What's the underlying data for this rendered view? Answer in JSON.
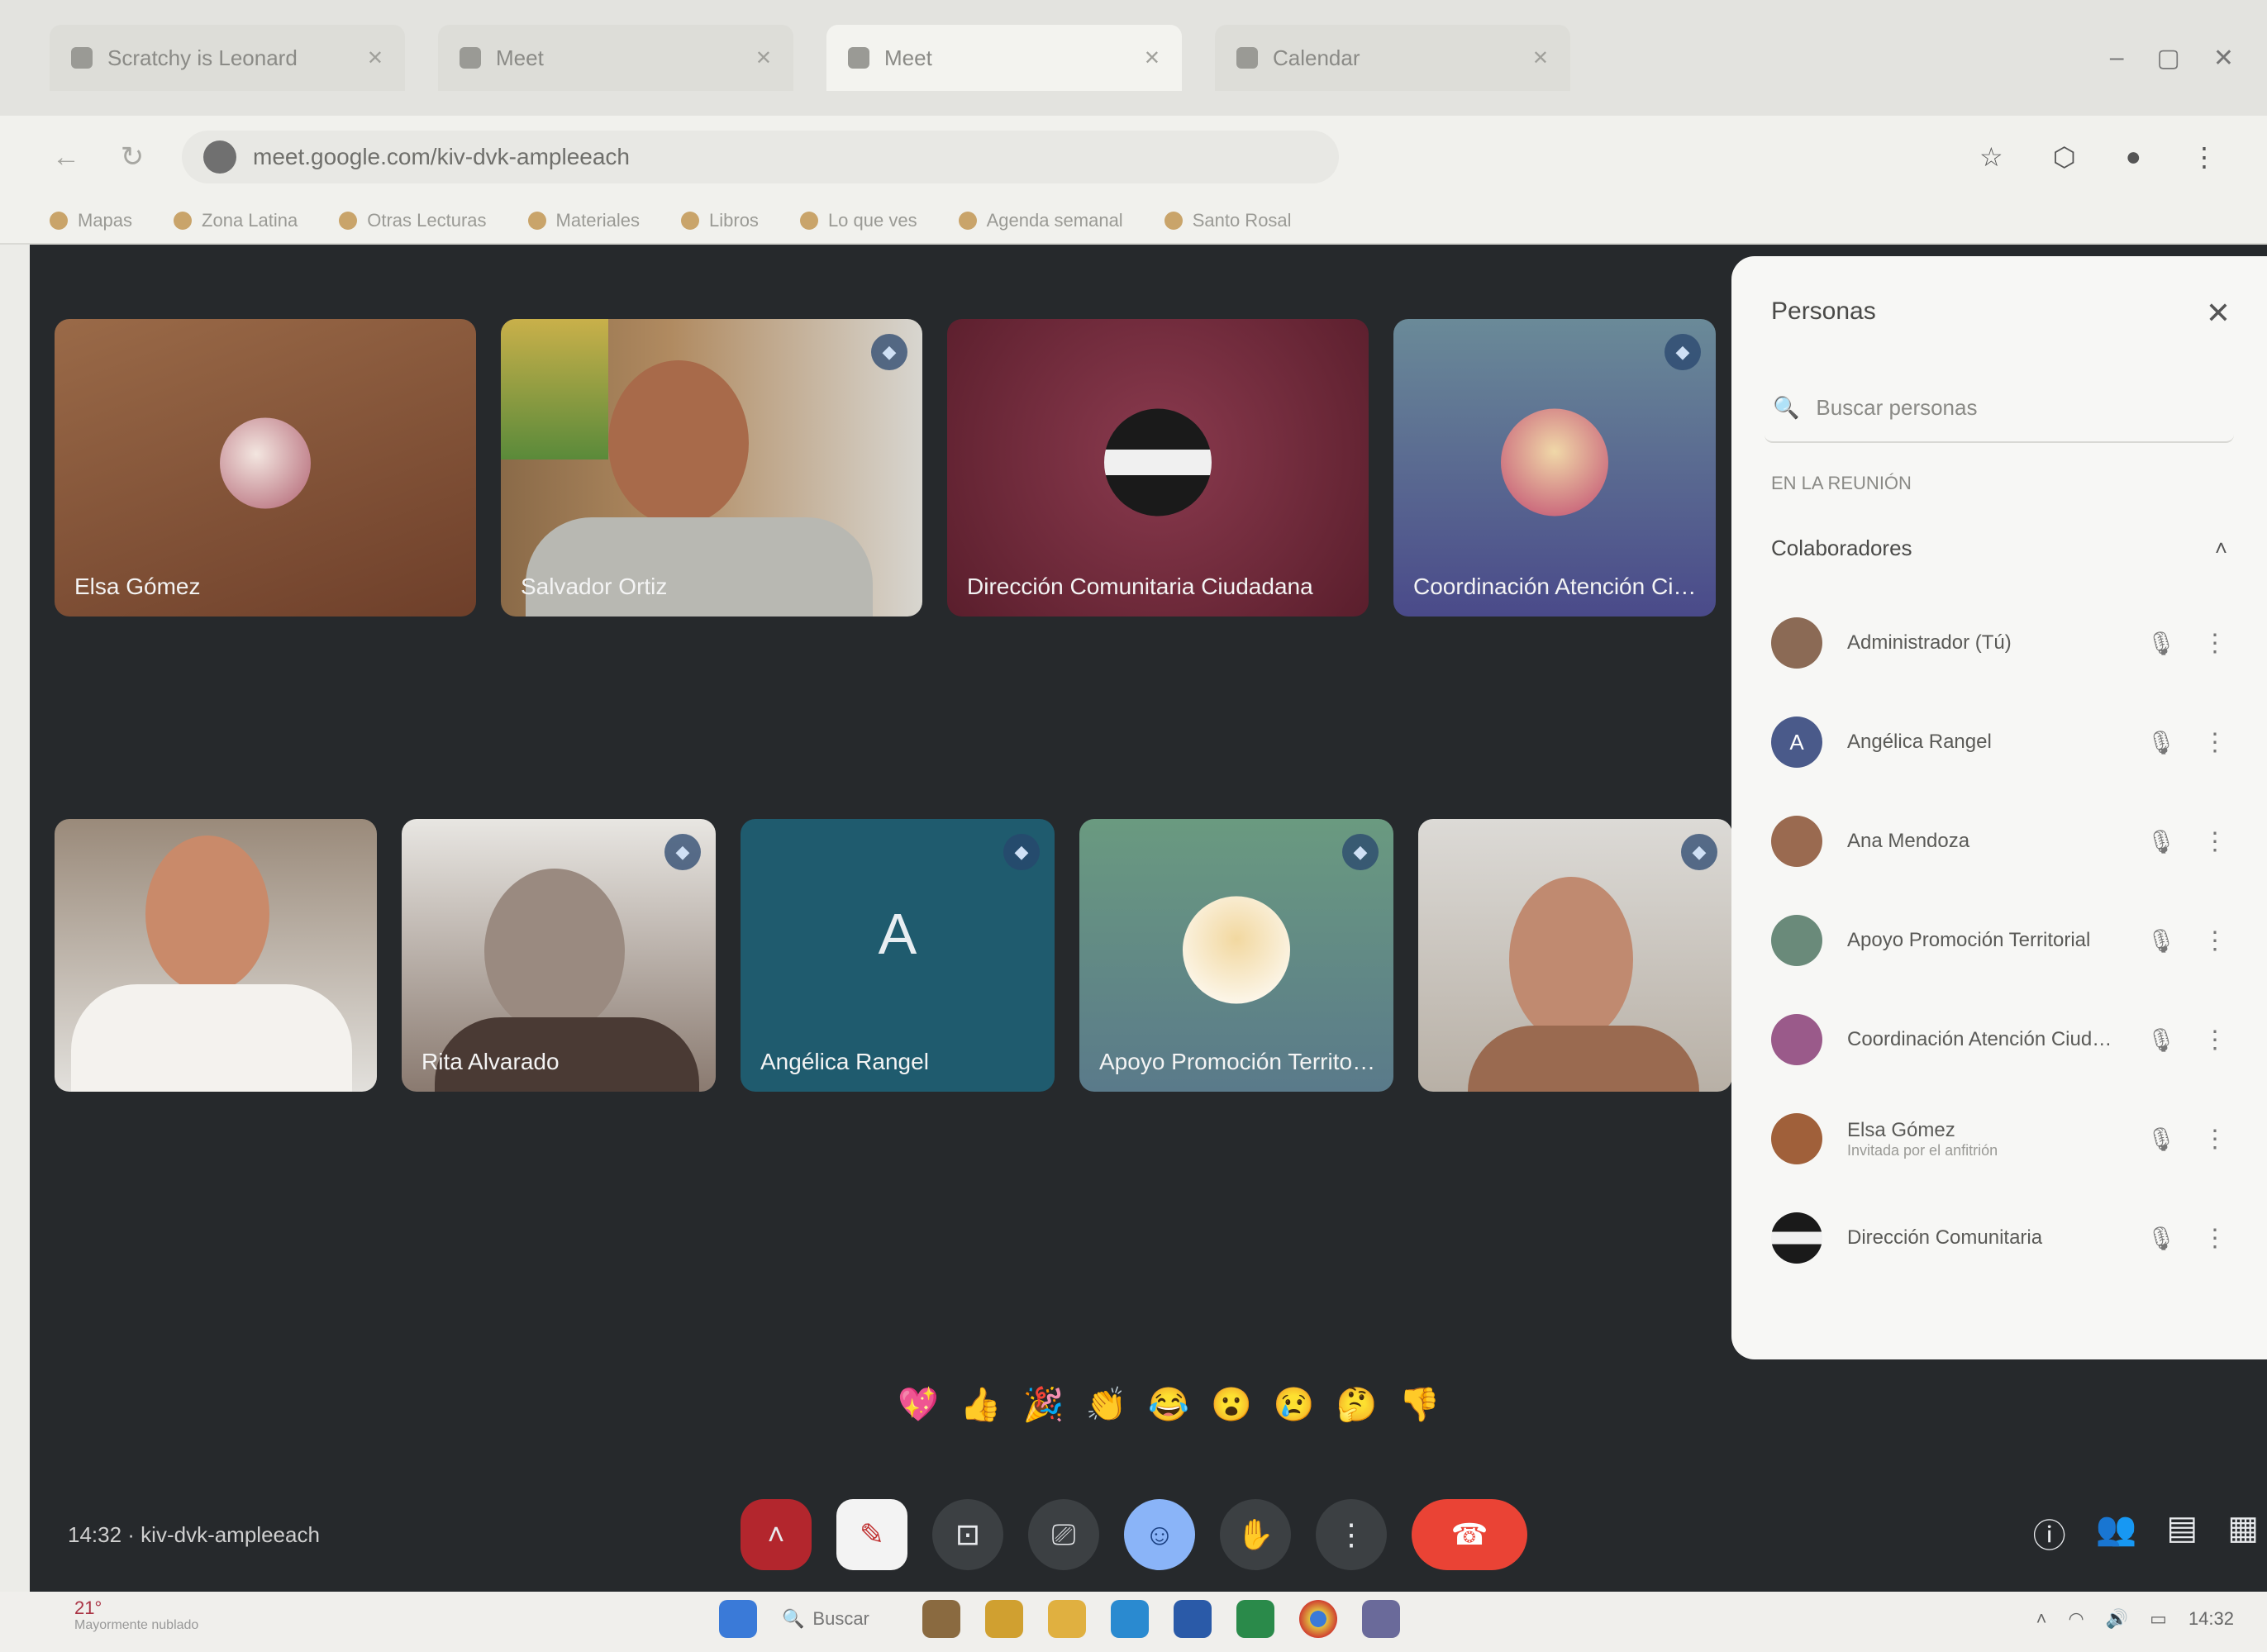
{
  "browser": {
    "tabs": [
      {
        "label": "Scratchy is Leonard",
        "active": false
      },
      {
        "label": "Meet",
        "active": false
      },
      {
        "label": "Meet",
        "active": true
      },
      {
        "label": "Calendar",
        "active": false
      }
    ],
    "url": "meet.google.com/kiv-dvk-ampleeach",
    "bookmarks": [
      "Mapas",
      "Zona Latina",
      "Otras Lecturas",
      "Materiales",
      "Libros",
      "Lo que ves",
      "Agenda semanal",
      "Santo Rosal"
    ]
  },
  "tiles": [
    {
      "name": "Elsa Gómez",
      "kind": "avatar",
      "bg": "#8c5a3c"
    },
    {
      "name": "Salvador Ortiz",
      "kind": "camera-man",
      "bg": "#7d6a4b"
    },
    {
      "name": "Dirección Comunitaria Ciudadana",
      "kind": "logo",
      "bg": "#7a3040"
    },
    {
      "name": "Coordinación Atención Ciudadana",
      "kind": "avatar",
      "bg": "#4b6a7a"
    },
    {
      "name": "",
      "kind": "camera-woman",
      "bg": "#c9c4bc"
    },
    {
      "name": "Rita Alvarado",
      "kind": "camera-elder",
      "bg": "#d8d6d2"
    },
    {
      "name": "Angélica Rangel",
      "kind": "letter",
      "letter": "A",
      "bg": "#1f5b6e"
    },
    {
      "name": "Apoyo Promoción Territorial",
      "kind": "avatar",
      "bg": "#5a8a7e"
    },
    {
      "name": "",
      "kind": "camera-woman2",
      "bg": "#d0ccc4"
    }
  ],
  "reactions": [
    "💖",
    "👍",
    "🎉",
    "👏",
    "😂",
    "😮",
    "😢",
    "🤔",
    "👎"
  ],
  "controls": {
    "clock": "14:32 · kiv-dvk-ampleeach",
    "mic_icon": "mic-off-icon",
    "end_icon": "phone-hangup-icon"
  },
  "panel": {
    "title": "Personas",
    "search_placeholder": "Buscar personas",
    "section": "EN LA REUNIÓN",
    "group": "Colaboradores",
    "people": [
      {
        "name": "Administrador (Tú)",
        "sub": "",
        "color": "#8b6a55",
        "initial": ""
      },
      {
        "name": "Angélica Rangel",
        "sub": "",
        "color": "#4a5a8a",
        "initial": "A"
      },
      {
        "name": "Ana Mendoza",
        "sub": "",
        "color": "#9a6a50",
        "initial": ""
      },
      {
        "name": "Apoyo Promoción Territorial",
        "sub": "",
        "color": "#6a8a7a",
        "initial": ""
      },
      {
        "name": "Coordinación Atención Ciudadana",
        "sub": "",
        "color": "#9a5a8a",
        "initial": ""
      },
      {
        "name": "Elsa Gómez",
        "sub": "Invitada por el anfitrión",
        "color": "#a0603a",
        "initial": ""
      },
      {
        "name": "Dirección Comunitaria",
        "sub": "",
        "color": "#2a2a30",
        "initial": ""
      }
    ]
  },
  "taskbar": {
    "weather": "21°",
    "weather_sub": "Mayormente nublado",
    "search": "Buscar",
    "tray_time": "14:32"
  },
  "colors": {
    "meet_bg": "#26292c",
    "end_call": "#ea4335",
    "accent_blue": "#8ab4f8"
  }
}
